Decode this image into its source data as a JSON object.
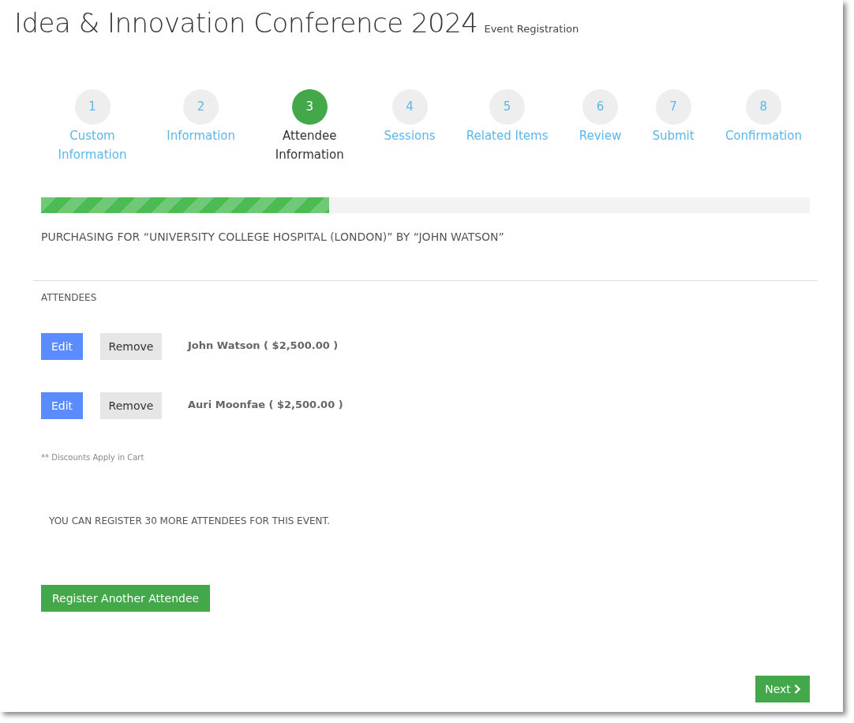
{
  "header": {
    "title": "Idea & Innovation Conference 2024",
    "subtitle": "Event Registration"
  },
  "steps": [
    {
      "number": "1",
      "label": "Custom Information",
      "selected": false
    },
    {
      "number": "2",
      "label": "Information",
      "selected": false
    },
    {
      "number": "3",
      "label": "Attendee Information",
      "selected": true
    },
    {
      "number": "4",
      "label": "Sessions",
      "selected": false
    },
    {
      "number": "5",
      "label": "Related Items",
      "selected": false
    },
    {
      "number": "6",
      "label": "Review",
      "selected": false
    },
    {
      "number": "7",
      "label": "Submit",
      "selected": false
    },
    {
      "number": "8",
      "label": "Confirmation",
      "selected": false
    }
  ],
  "progress": {
    "level": 0.375
  },
  "purchasing_text": "PURCHASING FOR “UNIVERSITY COLLEGE HOSPITAL (LONDON)” BY “JOHN WATSON”",
  "attendees_heading": "ATTENDEES",
  "attendees": [
    {
      "edit_label": "Edit",
      "remove_label": "Remove",
      "name": "John Watson ( $2,500.00 )"
    },
    {
      "edit_label": "Edit",
      "remove_label": "Remove",
      "name": "Auri Moonfae ( $2,500.00 )"
    }
  ],
  "discount_note": "** Discounts Apply in Cart",
  "capacity_text": "YOU CAN REGISTER 30 MORE ATTENDEES FOR THIS EVENT.",
  "register_button": "Register Another Attendee",
  "next_button": "Next"
}
